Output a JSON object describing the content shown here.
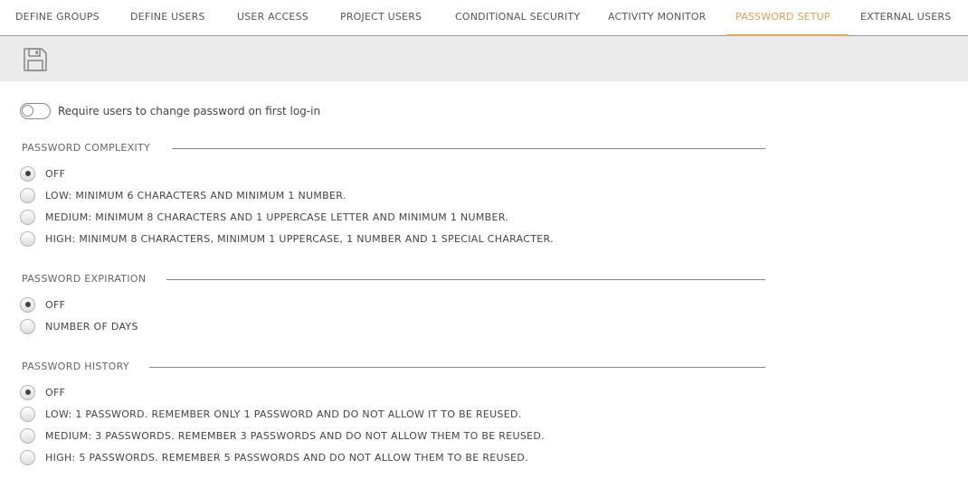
{
  "tabs": [
    {
      "label": "DEFINE GROUPS",
      "active": false
    },
    {
      "label": "DEFINE USERS",
      "active": false
    },
    {
      "label": "USER ACCESS",
      "active": false
    },
    {
      "label": "PROJECT USERS",
      "active": false
    },
    {
      "label": "CONDITIONAL SECURITY",
      "active": false
    },
    {
      "label": "ACTIVITY MONITOR",
      "active": false
    },
    {
      "label": "PASSWORD SETUP",
      "active": true
    },
    {
      "label": "EXTERNAL USERS",
      "active": false
    }
  ],
  "toolbar": {
    "save_icon": "save-icon"
  },
  "require_change": {
    "label": "Require users to change password on first log-in",
    "enabled": false
  },
  "complexity": {
    "title": "PASSWORD COMPLEXITY",
    "selected": 0,
    "options": [
      "OFF",
      "LOW: MINIMUM 6 CHARACTERS AND MINIMUM 1 NUMBER.",
      "MEDIUM: MINIMUM 8 CHARACTERS AND 1 UPPERCASE LETTER AND MINIMUM 1 NUMBER.",
      "HIGH: MINIMUM 8 CHARACTERS, MINIMUM 1 UPPERCASE, 1 NUMBER AND 1 SPECIAL CHARACTER."
    ]
  },
  "expiration": {
    "title": "PASSWORD EXPIRATION",
    "selected": 0,
    "options": [
      "OFF",
      "NUMBER OF DAYS"
    ]
  },
  "history": {
    "title": "PASSWORD HISTORY",
    "selected": 0,
    "options": [
      "OFF",
      "LOW: 1 PASSWORD. REMEMBER ONLY 1 PASSWORD AND DO NOT ALLOW IT TO BE REUSED.",
      "MEDIUM: 3 PASSWORDS. REMEMBER 3 PASSWORDS AND DO NOT ALLOW THEM TO BE REUSED.",
      "HIGH: 5 PASSWORDS. REMEMBER 5 PASSWORDS AND DO NOT ALLOW THEM TO BE REUSED."
    ]
  },
  "colors": {
    "accent": "#e8a851",
    "toolbar_bg": "#ebebeb",
    "text": "#444444"
  }
}
